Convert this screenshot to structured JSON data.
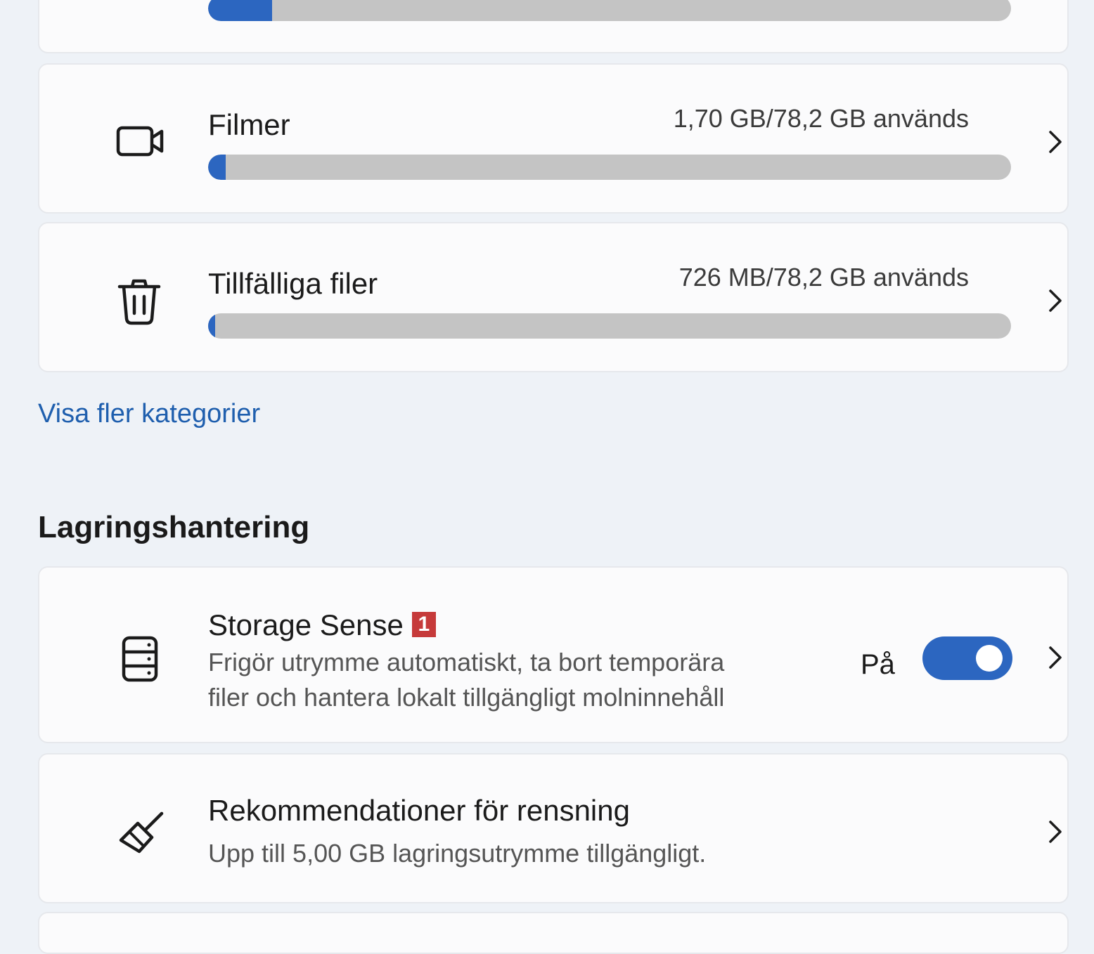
{
  "categories": [
    {
      "name": "",
      "usage": "",
      "fraction": 0.08,
      "icon": "unknown-icon"
    },
    {
      "name": "Filmer",
      "usage": "1,70 GB/78,2 GB används",
      "fraction": 0.022,
      "icon": "video-camera-icon"
    },
    {
      "name": "Tillfälliga filer",
      "usage": "726 MB/78,2 GB används",
      "fraction": 0.009,
      "icon": "trash-icon"
    }
  ],
  "show_more_link": "Visa fler kategorier",
  "storage_management": {
    "heading": "Lagringshantering",
    "storage_sense": {
      "title": "Storage Sense",
      "badge": "1",
      "description_line1": "Frigör utrymme automatiskt, ta bort temporära",
      "description_line2": "filer och hantera lokalt tillgängligt molninnehåll",
      "toggle_label": "På",
      "toggle_on": true,
      "icon": "storage-drive-icon"
    },
    "cleanup": {
      "title": "Rekommendationer för rensning",
      "description": "Upp till 5,00 GB lagringsutrymme tillgängligt.",
      "icon": "broom-icon"
    }
  },
  "colors": {
    "accent": "#2c66c0",
    "link": "#1f5fae",
    "badge": "#c63a3a"
  }
}
